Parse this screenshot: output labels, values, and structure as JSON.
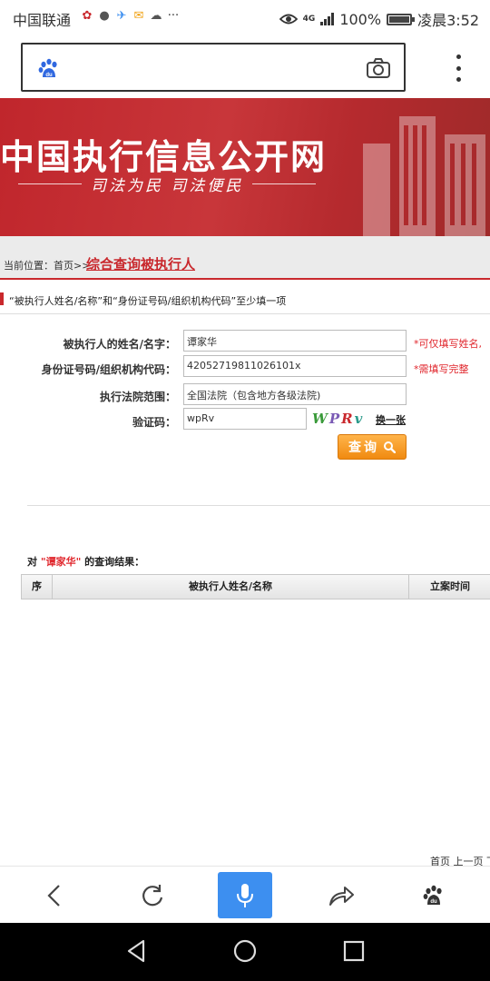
{
  "status_bar": {
    "carrier": "中国联通",
    "network": "4G",
    "battery": "100%",
    "time": "凌晨3:52",
    "more": "···"
  },
  "browser": {
    "address": ""
  },
  "banner": {
    "title": "中国执行信息公开网",
    "slogan": "司法为民  司法便民"
  },
  "breadcrumb": {
    "prefix": "当前位置：首页>>",
    "current": "综合查询被执行人"
  },
  "hint": "“被执行人姓名/名称”和“身份证号码/组织机构代码”至少填一项",
  "form": {
    "name_label": "被执行人的姓名/名字：",
    "name_value": "谭家华",
    "name_note": "*可仅填写姓名,",
    "id_label": "身份证号码/组织机构代码：",
    "id_value": "42052719811026101x",
    "id_note": "*需填写完整",
    "court_label": "执行法院范围：",
    "court_value": "全国法院（包含地方各级法院)",
    "captcha_label": "验证码：",
    "captcha_value": "wpRv",
    "captcha_image": [
      "W",
      "P",
      "R",
      "v"
    ],
    "change_captcha": "换一张",
    "query_button": "查询"
  },
  "result": {
    "prefix": "对",
    "name": "\"谭家华\"",
    "suffix": "的查询结果：",
    "columns": [
      "序",
      "被执行人姓名/名称",
      "立案时间"
    ]
  },
  "pager": "首页 上一页 下",
  "colors": {
    "brand_red": "#c9282d",
    "note_red": "#e0262c",
    "button_orange": "#f08a10",
    "mic_blue": "#3d8ff0"
  }
}
